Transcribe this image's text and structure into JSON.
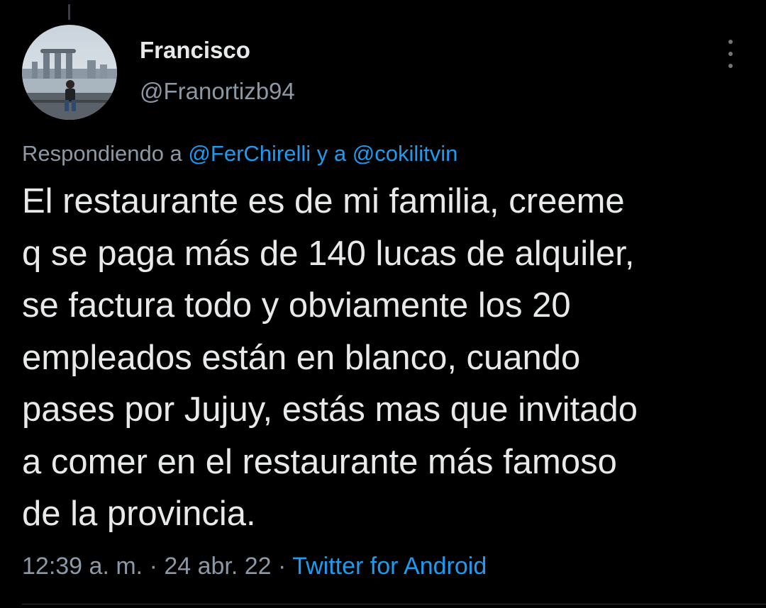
{
  "tweet": {
    "author": {
      "display_name": "Francisco",
      "handle": "@Franortizb94",
      "avatar_icon": "profile-photo"
    },
    "more_icon": "more-vertical-icon",
    "replying": {
      "prefix": "Respondiendo a",
      "user1": "@FerChirelli",
      "connector": "y a",
      "user2": "@cokilitvin"
    },
    "text_lines": [
      "El restaurante es de mi familia, creeme",
      "q se paga más de 140 lucas de alquiler,",
      "se factura todo y obviamente los 20",
      "empleados están en blanco, cuando",
      "pases por Jujuy, estás mas que invitado",
      "a comer en el restaurante más famoso",
      "de la provincia."
    ],
    "meta": {
      "time": "12:39 a. m.",
      "separator": "·",
      "date": "24 abr. 22",
      "source": "Twitter for Android"
    }
  },
  "colors": {
    "background": "#000000",
    "text": "#e7e9ea",
    "secondary": "#8b98a5",
    "link": "#1d9bf0"
  }
}
